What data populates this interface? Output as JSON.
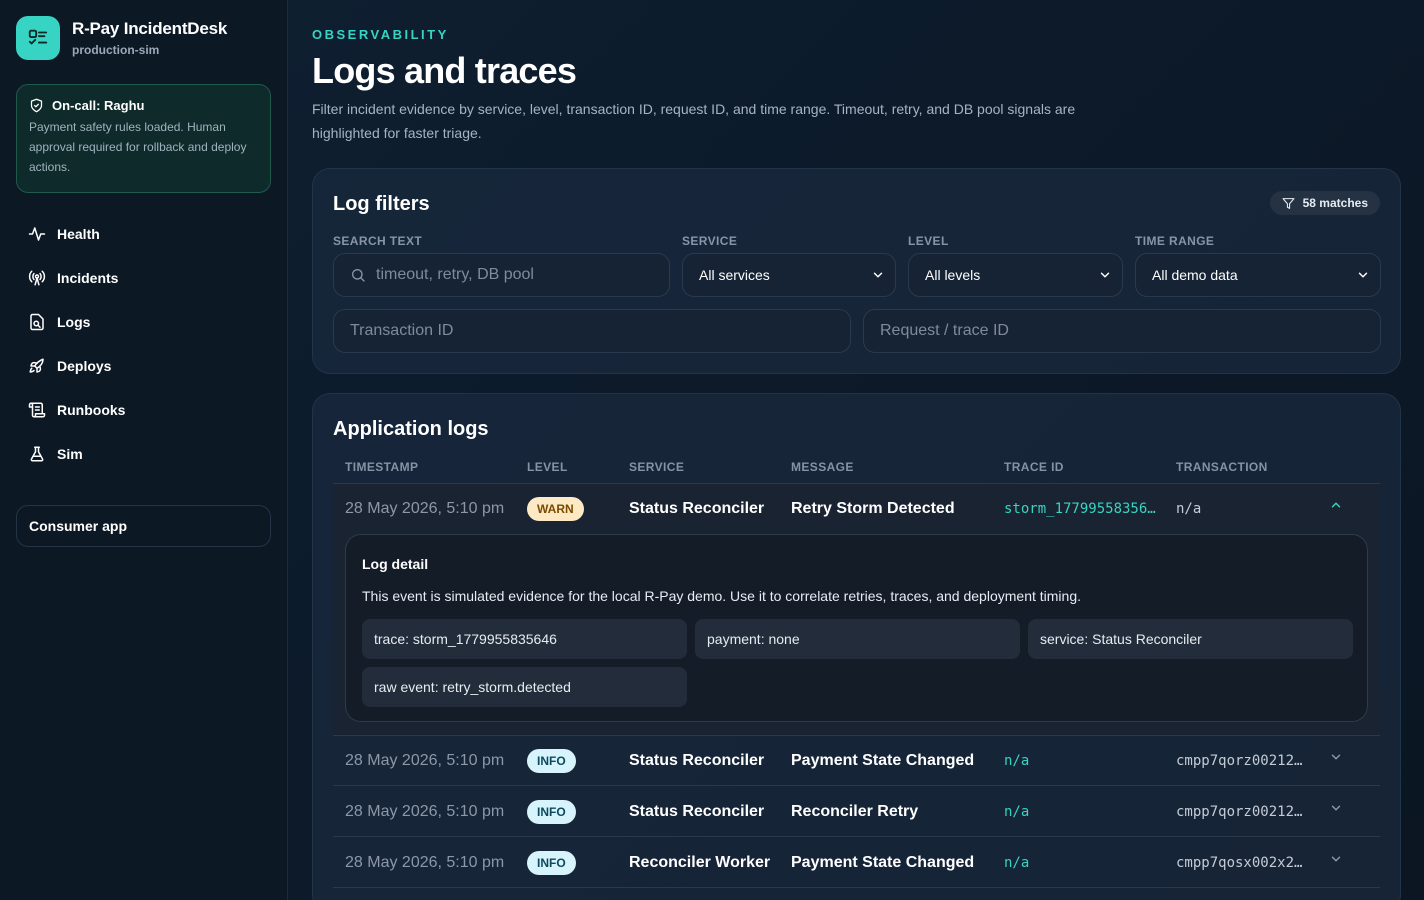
{
  "brand": {
    "name": "R-Pay IncidentDesk",
    "subtitle": "production-sim"
  },
  "oncall": {
    "title": "On-call: Raghu",
    "body": "Payment safety rules loaded. Human approval required for rollback and deploy actions."
  },
  "nav": {
    "items": [
      {
        "label": "Health",
        "icon": "activity-icon"
      },
      {
        "label": "Incidents",
        "icon": "radio-tower-icon"
      },
      {
        "label": "Logs",
        "icon": "file-search-icon"
      },
      {
        "label": "Deploys",
        "icon": "rocket-icon"
      },
      {
        "label": "Runbooks",
        "icon": "scroll-icon"
      },
      {
        "label": "Sim",
        "icon": "flask-icon"
      }
    ],
    "consumer_app": "Consumer app"
  },
  "header": {
    "eyebrow": "OBSERVABILITY",
    "title": "Logs and traces",
    "description": "Filter incident evidence by service, level, transaction ID, request ID, and time range. Timeout, retry, and DB pool signals are highlighted for faster triage."
  },
  "filters": {
    "title": "Log filters",
    "matches": "58 matches",
    "search_label": "SEARCH TEXT",
    "search_placeholder": "timeout, retry, DB pool",
    "service_label": "SERVICE",
    "service_value": "All services",
    "level_label": "LEVEL",
    "level_value": "All levels",
    "time_label": "TIME RANGE",
    "time_value": "All demo data",
    "transaction_placeholder": "Transaction ID",
    "request_placeholder": "Request / trace ID"
  },
  "logs": {
    "title": "Application logs",
    "columns": {
      "timestamp": "TIMESTAMP",
      "level": "LEVEL",
      "service": "SERVICE",
      "message": "MESSAGE",
      "trace": "TRACE ID",
      "transaction": "TRANSACTION"
    },
    "expanded": {
      "timestamp": "28 May 2026, 5:10 pm",
      "level": "WARN",
      "service": "Status Reconciler",
      "message": "Retry Storm Detected",
      "trace": "storm_17799558356…",
      "transaction": "n/a",
      "detail_title": "Log detail",
      "detail_text": "This event is simulated evidence for the local R-Pay demo. Use it to correlate retries, traces, and deployment timing.",
      "chips": [
        "trace: storm_1779955835646",
        "payment: none",
        "service: Status Reconciler",
        "raw event: retry_storm.detected"
      ]
    },
    "rows": [
      {
        "timestamp": "28 May 2026, 5:10 pm",
        "level": "INFO",
        "service": "Status Reconciler",
        "message": "Payment State Changed",
        "trace": "n/a",
        "transaction": "cmpp7qorz00212…"
      },
      {
        "timestamp": "28 May 2026, 5:10 pm",
        "level": "INFO",
        "service": "Status Reconciler",
        "message": "Reconciler Retry",
        "trace": "n/a",
        "transaction": "cmpp7qorz00212…"
      },
      {
        "timestamp": "28 May 2026, 5:10 pm",
        "level": "INFO",
        "service": "Reconciler Worker",
        "message": "Payment State Changed",
        "trace": "n/a",
        "transaction": "cmpp7qosx002x2…"
      }
    ]
  }
}
